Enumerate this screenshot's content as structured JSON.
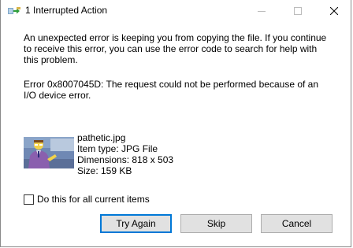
{
  "window": {
    "title": "1 Interrupted Action"
  },
  "message": {
    "main": "An unexpected error is keeping you from copying the file. If you continue to receive this error, you can use the error code to search for help with this problem.",
    "error": "Error 0x8007045D: The request could not be performed because of an I/O device error."
  },
  "file": {
    "name": "pathetic.jpg",
    "type": "Item type: JPG File",
    "dimensions": "Dimensions: 818 x 503",
    "size": "Size: 159 KB"
  },
  "checkbox": {
    "label": "Do this for all current items",
    "checked": false
  },
  "buttons": {
    "try_again": "Try Again",
    "skip": "Skip",
    "cancel": "Cancel"
  },
  "colors": {
    "focus_border": "#0078d7",
    "button_bg": "#e1e1e1",
    "button_border": "#adadad"
  },
  "icons": {
    "title": "copy-progress-icon",
    "minimize": "minimize-icon",
    "maximize": "maximize-icon",
    "close": "close-icon"
  }
}
